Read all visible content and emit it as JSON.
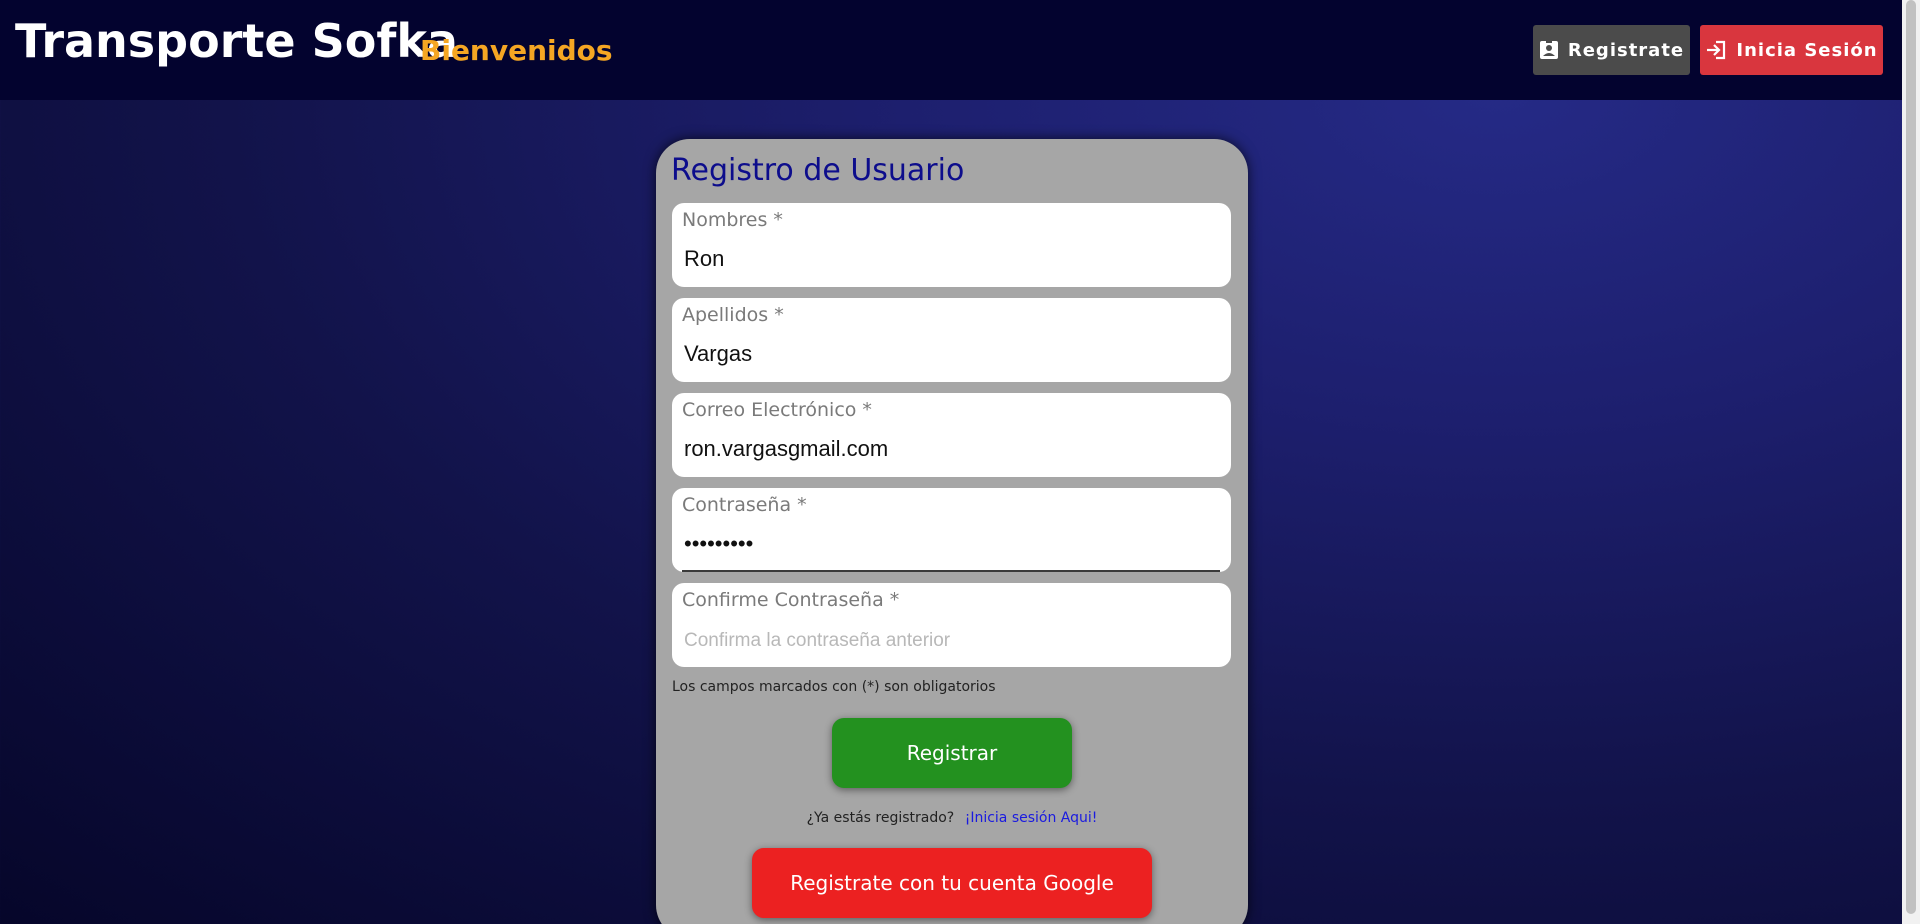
{
  "header": {
    "brand": "Transporte Sofka",
    "welcome": "Bienvenidos",
    "register_label": "Registrate",
    "login_label": "Inicia Sesión",
    "register_icon": "contact-badge-icon",
    "login_icon": "login-arrow-icon"
  },
  "form": {
    "title": "Registro de Usuario",
    "fields": [
      {
        "label": "Nombres *",
        "value": "Ron",
        "placeholder": ""
      },
      {
        "label": "Apellidos *",
        "value": "Vargas",
        "placeholder": ""
      },
      {
        "label": "Correo Electrónico *",
        "value": "ron.vargasgmail.com",
        "placeholder": ""
      },
      {
        "label": "Contraseña *",
        "value": "•••••••••",
        "placeholder": ""
      },
      {
        "label": "Confirme Contraseña *",
        "value": "",
        "placeholder": "Confirma la contraseña anterior"
      }
    ],
    "required_note": "Los campos marcados con (*) son obligatorios",
    "submit_label": "Registrar",
    "already_text": "¿Ya estás registrado?",
    "login_link": "¡Inicia sesión Aqui!",
    "google_label": "Registrate con tu cuenta Google"
  },
  "colors": {
    "navbar": "#03032f",
    "accent_orange": "#f5a623",
    "register_button": "#4b4b4b",
    "login_button": "#d9363e",
    "submit_button": "#23911f",
    "google_button": "#ec2121",
    "title_blue": "#0d0d8c"
  }
}
